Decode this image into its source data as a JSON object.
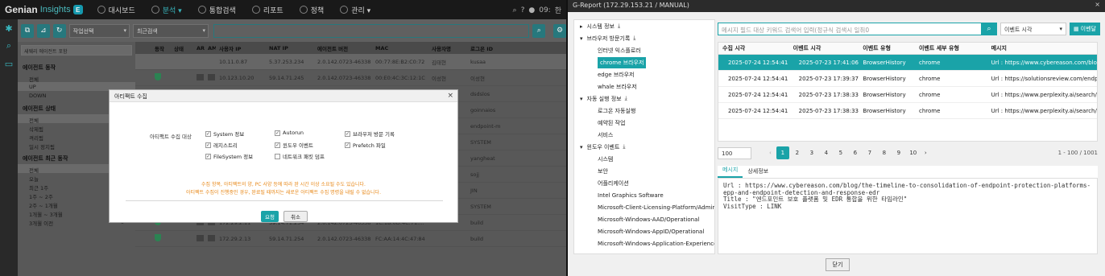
{
  "left": {
    "brand": {
      "name": "Genian",
      "product": "Insights",
      "badge": "E"
    },
    "nav": [
      {
        "label": "대시보드",
        "icon": "dashboard-icon"
      },
      {
        "label": "분석 ▾",
        "icon": "chart-icon",
        "active": true
      },
      {
        "label": "통합검색",
        "icon": "search-icon"
      },
      {
        "label": "리포트",
        "icon": "report-icon"
      },
      {
        "label": "정책",
        "icon": "policy-icon"
      },
      {
        "label": "관리 ▾",
        "icon": "settings-icon"
      }
    ],
    "nav_right": {
      "time": "09:",
      "lang": "한"
    },
    "toolbar": {
      "action_select": "작업선택",
      "filter_select": "최근검색"
    },
    "filter_panel": {
      "search_placeholder": "새웨리 에이전트 포함",
      "sections": [
        {
          "title": "에이전트 동작",
          "items": [
            {
              "label": "전체",
              "count": ""
            },
            {
              "label": "UP",
              "count": "",
              "selected": true
            },
            {
              "label": "DOWN",
              "count": ""
            }
          ]
        },
        {
          "title": "에이전트 상태",
          "items": [
            {
              "label": "전체",
              "count": "",
              "selected": true
            },
            {
              "label": "삭제됨",
              "count": ""
            },
            {
              "label": "격리됨",
              "count": ""
            },
            {
              "label": "일시 정지됨",
              "count": ""
            }
          ]
        },
        {
          "title": "에이전트 최근 동작",
          "items": [
            {
              "label": "전체",
              "count": "",
              "selected": true
            },
            {
              "label": "오늘",
              "count": ""
            },
            {
              "label": "최근 1주",
              "count": ""
            },
            {
              "label": "1주 ~ 2주",
              "count": ""
            },
            {
              "label": "2주 ~ 1개월",
              "count": "62"
            },
            {
              "label": "1개월 ~ 3개월",
              "count": "0"
            },
            {
              "label": "3개월 이전",
              "count": "0"
            }
          ]
        }
      ]
    },
    "grid": {
      "columns": [
        "동작",
        "상태",
        "AR",
        "AM",
        "사용자 IP",
        "NAT IP",
        "에이전트 버전",
        "MAC",
        "사용자명",
        "로그온 ID"
      ],
      "rows": [
        {
          "ip": "10.11.0.87",
          "nat": "5.37.253.234",
          "ver": "2.0.142.0723-46338",
          "mac": "00:77:8E:B2:C0:72",
          "user": "김태현",
          "logon": "kusaa"
        },
        {
          "ip": "10.123.10.20",
          "nat": "59.14.71.245",
          "ver": "2.0.142.0723-46338",
          "mac": "00:E0:4C:3C:12:1C",
          "user": "이성현",
          "logon": "이성현"
        },
        {
          "ip": "",
          "nat": "",
          "ver": "",
          "mac": "",
          "user": "",
          "logon": "dsdslos"
        },
        {
          "ip": "",
          "nat": "",
          "ver": "",
          "mac": "",
          "user": "",
          "logon": "goinnaios"
        },
        {
          "ip": "",
          "nat": "",
          "ver": "",
          "mac": "",
          "user": "",
          "logon": "endpoint-m"
        },
        {
          "ip": "",
          "nat": "",
          "ver": "",
          "mac": "",
          "user": "정지웅",
          "logon": "SYSTEM"
        },
        {
          "ip": "",
          "nat": "",
          "ver": "",
          "mac": "",
          "user": "",
          "logon": "yangheat"
        },
        {
          "ip": "",
          "nat": "",
          "ver": "",
          "mac": "",
          "user": "",
          "logon": "sojj"
        },
        {
          "ip": "",
          "nat": "",
          "ver": "",
          "mac": "",
          "user": "",
          "logon": "JIN"
        },
        {
          "ip": "172.29.2.10",
          "nat": "59.14.71.254",
          "ver": "2.0.142.0723-46338",
          "mac": "00:0C:29:CE:DE:...",
          "user": "",
          "logon": "SYSTEM"
        },
        {
          "ip": "172.29.2.11",
          "nat": "59.14.71.254",
          "ver": "2.0.142.0723-46338",
          "mac": "1C:1B:0D:4C:71:...",
          "user": "",
          "logon": "build"
        },
        {
          "ip": "172.29.2.13",
          "nat": "59.14.71.254",
          "ver": "2.0.142.0723-46338",
          "mac": "FC:AA:14:4C:47:84",
          "user": "",
          "logon": "build"
        }
      ]
    },
    "modal": {
      "title": "아티팩트 수집",
      "target_label": "아티팩트 수집 대상",
      "options": [
        {
          "label": "System 정보",
          "checked": true
        },
        {
          "label": "Autorun",
          "checked": true
        },
        {
          "label": "브라우저 방문 기록",
          "checked": true
        },
        {
          "label": "레지스트리",
          "checked": true
        },
        {
          "label": "윈도우 이벤트",
          "checked": true
        },
        {
          "label": "Prefetch 파일",
          "checked": true
        },
        {
          "label": "FileSystem 정보",
          "checked": true
        },
        {
          "label": "네트워크 패킷 덤프",
          "checked": false
        }
      ],
      "note1": "수집 항목, 아티팩트의 양, PC 사양 등에 따라 완 시간 이상 소요될 수도 있습니다.",
      "note2": "아티팩트 수집이 진행중인 경우, 완료될 때까지는 새로운 아티팩트 수집 명령을 내릴 수 없습니다.",
      "ok": "요청",
      "cancel": "취소"
    }
  },
  "right": {
    "window_title": "G-Report (172.29.153.21 / MANUAL)",
    "tree": [
      {
        "label": "시스템 정보",
        "level": 0,
        "expander": "▸",
        "download": true
      },
      {
        "label": "브라우저 방문기록",
        "level": 0,
        "expander": "▾",
        "download": true
      },
      {
        "label": "인터넷 익스플로러",
        "level": 1
      },
      {
        "label": "chrome 브라우저",
        "level": 1,
        "selected": true
      },
      {
        "label": "edge 브라우저",
        "level": 1
      },
      {
        "label": "whale 브라우저",
        "level": 1
      },
      {
        "label": "자동 실행 정보",
        "level": 0,
        "expander": "▾",
        "download": true
      },
      {
        "label": "로그온 자동실행",
        "level": 1
      },
      {
        "label": "예약된 작업",
        "level": 1
      },
      {
        "label": "서비스",
        "level": 1
      },
      {
        "label": "윈도우 이벤트",
        "level": 0,
        "expander": "▾",
        "download": true
      },
      {
        "label": "시스템",
        "level": 1
      },
      {
        "label": "보안",
        "level": 1
      },
      {
        "label": "어플리케이션",
        "level": 1
      },
      {
        "label": "Intel Graphics Software",
        "level": 1
      },
      {
        "label": "Microsoft-Client-Licensing-Platform/Admin",
        "level": 1
      },
      {
        "label": "Microsoft-Windows-AAD/Operational",
        "level": 1
      },
      {
        "label": "Microsoft-Windows-AppID/Operational",
        "level": 1
      },
      {
        "label": "Microsoft-Windows-Application-Experience",
        "level": 1
      }
    ],
    "search_placeholder": "메시지 필드 대상 키워드 검색어 입력(정규식 검색시 일취0",
    "sort_select": "이벤트 시각",
    "export_label": "이벤달",
    "table": {
      "columns": [
        "수집 시각",
        "이벤트 시각",
        "이벤트 유형",
        "이벤트 세부 유형",
        "메시지"
      ],
      "rows": [
        {
          "collected": "2025-07-24 12:54:41",
          "event": "2025-07-23 17:41:06",
          "type": "BrowserHistory",
          "subtype": "chrome",
          "message": "Url : https://www.cybereason.com/blog/th...",
          "selected": true
        },
        {
          "collected": "2025-07-24 12:54:41",
          "event": "2025-07-23 17:39:37",
          "type": "BrowserHistory",
          "subtype": "chrome",
          "message": "Url : https://solutionsreview.com/endpoin..."
        },
        {
          "collected": "2025-07-24 12:54:41",
          "event": "2025-07-23 17:38:33",
          "type": "BrowserHistory",
          "subtype": "chrome",
          "message": "Url : https://www.perplexity.ai/search/ne..."
        },
        {
          "collected": "2025-07-24 12:54:41",
          "event": "2025-07-23 17:38:33",
          "type": "BrowserHistory",
          "subtype": "chrome",
          "message": "Url : https://www.perplexity.ai/search/gat..."
        }
      ]
    },
    "pager": {
      "page_size": "100",
      "pages": [
        "1",
        "2",
        "3",
        "4",
        "5",
        "6",
        "7",
        "8",
        "9",
        "10"
      ],
      "current": "1",
      "range": "1 - 100 / 1001"
    },
    "tabs": [
      "메시지",
      "상세정보"
    ],
    "detail": "Url : https://www.cybereason.com/blog/the-timeline-to-consolidation-of-endpoint-protection-platforms-epp-and-endpoint-detection-and-response-edr\nTitle : \"엔드포인트 보호 플랫폼 및 EDR 통합을 위한 타임라인\"\nVisitType : LINK",
    "close_button": "닫기"
  }
}
